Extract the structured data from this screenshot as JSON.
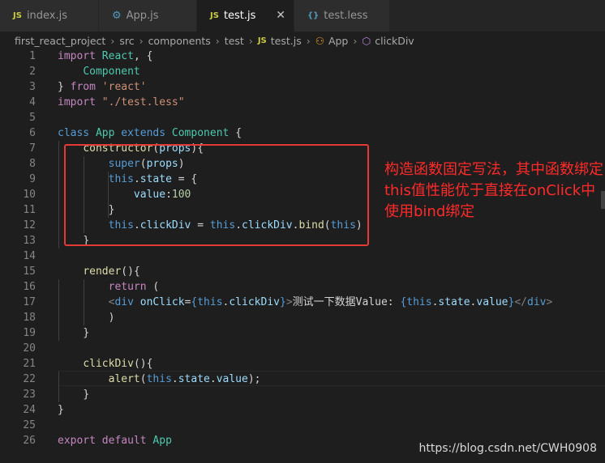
{
  "tabs": [
    {
      "icon": "JS",
      "label": "index.js"
    },
    {
      "icon": "⚙",
      "label": "App.js"
    },
    {
      "icon": "JS",
      "label": "test.js",
      "close": "✕"
    },
    {
      "icon": "{}",
      "label": "test.less"
    }
  ],
  "breadcrumb": {
    "items": [
      "first_react_project",
      "src",
      "components",
      "test",
      "test.js",
      "App",
      "clickDiv"
    ],
    "file_icon": "JS"
  },
  "code_lines": [
    "import React, {",
    "    Component",
    "} from 'react'",
    "import \"./test.less\"",
    "",
    "class App extends Component {",
    "    constructor(props){",
    "        super(props)",
    "        this.state = {",
    "            value:100",
    "        }",
    "        this.clickDiv = this.clickDiv.bind(this)",
    "    }",
    "",
    "    render(){",
    "        return (",
    "        <div onClick={this.clickDiv}>测试一下数据Value: {this.state.value}</div>",
    "        )",
    "    }",
    "",
    "    clickDiv(){",
    "        alert(this.state.value);",
    "    }",
    "}",
    "",
    "export default App"
  ],
  "line_numbers": [
    "1",
    "2",
    "3",
    "4",
    "5",
    "6",
    "7",
    "8",
    "9",
    "10",
    "11",
    "12",
    "13",
    "14",
    "15",
    "16",
    "17",
    "18",
    "19",
    "20",
    "21",
    "22",
    "23",
    "24",
    "25",
    "26"
  ],
  "annotation": "构造函数固定写法，其中函数绑定this值性能优于直接在onClick中使用bind绑定",
  "watermark": "https://blog.csdn.net/CWH0908",
  "colors": {
    "annotation": "#ff2a2a",
    "box": "#e53935",
    "background": "#1e1e1e"
  }
}
